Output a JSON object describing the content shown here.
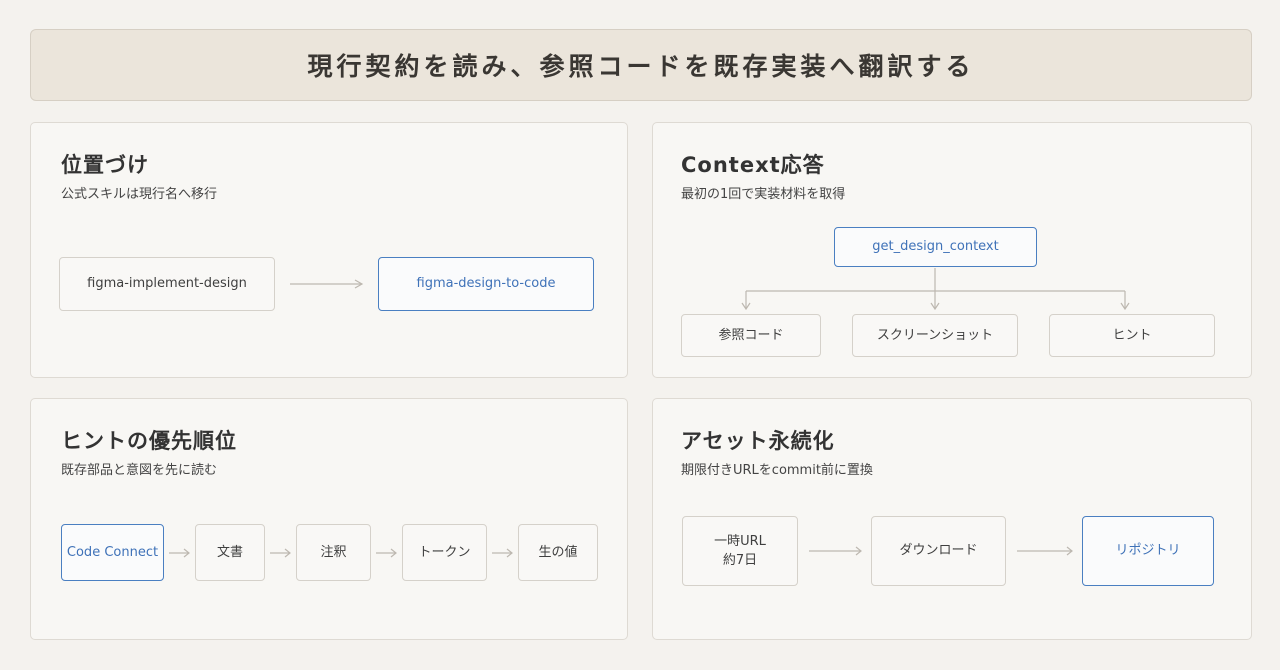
{
  "banner": {
    "title": "現行契約を読み、参照コードを既存実装へ翻訳する"
  },
  "positioning": {
    "title": "位置づけ",
    "subtitle": "公式スキルは現行名へ移行",
    "from": "figma-implement-design",
    "to": "figma-design-to-code"
  },
  "context": {
    "title": "Context応答",
    "subtitle": "最初の1回で実装材料を取得",
    "root": "get_design_context",
    "children": [
      "参照コード",
      "スクリーンショット",
      "ヒント"
    ]
  },
  "hints": {
    "title": "ヒントの優先順位",
    "subtitle": "既存部品と意図を先に読む",
    "steps": [
      "Code Connect",
      "文書",
      "注釈",
      "トークン",
      "生の値"
    ]
  },
  "assets": {
    "title": "アセット永続化",
    "subtitle": "期限付きURLをcommit前に置換",
    "step1_line1": "一時URL",
    "step1_line2": "約7日",
    "step2": "ダウンロード",
    "step3": "リポジトリ"
  },
  "colors": {
    "accent": "#4a7fc1",
    "arrow": "#bdb8b0",
    "banner_bg": "#ebe5db"
  }
}
